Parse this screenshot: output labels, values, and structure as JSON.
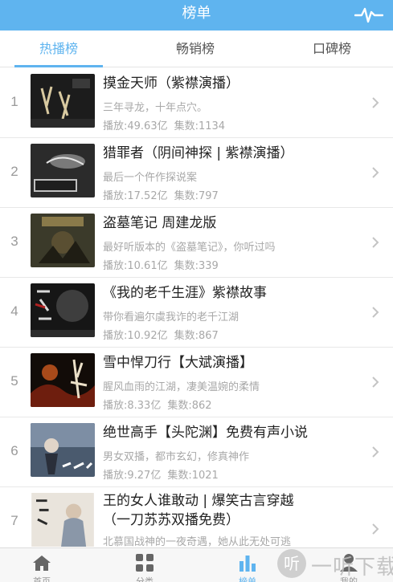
{
  "header": {
    "title": "榜单",
    "right_icon": "pulse-icon"
  },
  "tabs": [
    {
      "label": "热播榜",
      "active": true
    },
    {
      "label": "畅销榜",
      "active": false
    },
    {
      "label": "口碑榜",
      "active": false
    }
  ],
  "items": [
    {
      "rank": "1",
      "title": "摸金天师（紫襟演播）",
      "desc": "三年寻龙，十年点穴。",
      "plays": "播放:49.63亿",
      "episodes": "集数:1134"
    },
    {
      "rank": "2",
      "title": "猎罪者（阴间神探 | 紫襟演播）",
      "desc": "最后一个仵作探说案",
      "plays": "播放:17.52亿",
      "episodes": "集数:797"
    },
    {
      "rank": "3",
      "title": "盗墓笔记 周建龙版",
      "desc": "最好听版本的《盗墓笔记》，你听过吗",
      "plays": "播放:10.61亿",
      "episodes": "集数:339"
    },
    {
      "rank": "4",
      "title": "《我的老千生涯》紫襟故事",
      "desc": "带你看遍尔虞我诈的老千江湖",
      "plays": "播放:10.92亿",
      "episodes": "集数:867"
    },
    {
      "rank": "5",
      "title": "雪中悍刀行【大斌演播】",
      "desc": "腥风血雨的江湖，凄美温婉的柔情",
      "plays": "播放:8.33亿",
      "episodes": "集数:862"
    },
    {
      "rank": "6",
      "title": "绝世高手【头陀渊】免费有声小说",
      "desc": "男女双播，都市玄幻，修真神作",
      "plays": "播放:9.27亿",
      "episodes": "集数:1021"
    },
    {
      "rank": "7",
      "title_line1": "王的女人谁敢动 | 爆笑古言穿越",
      "title_line2": "（一刀苏苏双播免费）",
      "desc": "北慕国战神的一夜奇遇，她从此无处可逃"
    }
  ],
  "nav": [
    {
      "label": "首页",
      "icon": "home-icon",
      "active": false
    },
    {
      "label": "分类",
      "icon": "grid-icon",
      "active": false
    },
    {
      "label": "榜单",
      "icon": "bar-chart-icon",
      "active": true
    },
    {
      "label": "我的",
      "icon": "user-icon",
      "active": false
    }
  ],
  "watermark": {
    "glyph": "听",
    "text": "一听下载"
  },
  "colors": {
    "accent": "#5fb4ef",
    "title_text": "#222222",
    "muted_text": "#a8a8a8"
  }
}
